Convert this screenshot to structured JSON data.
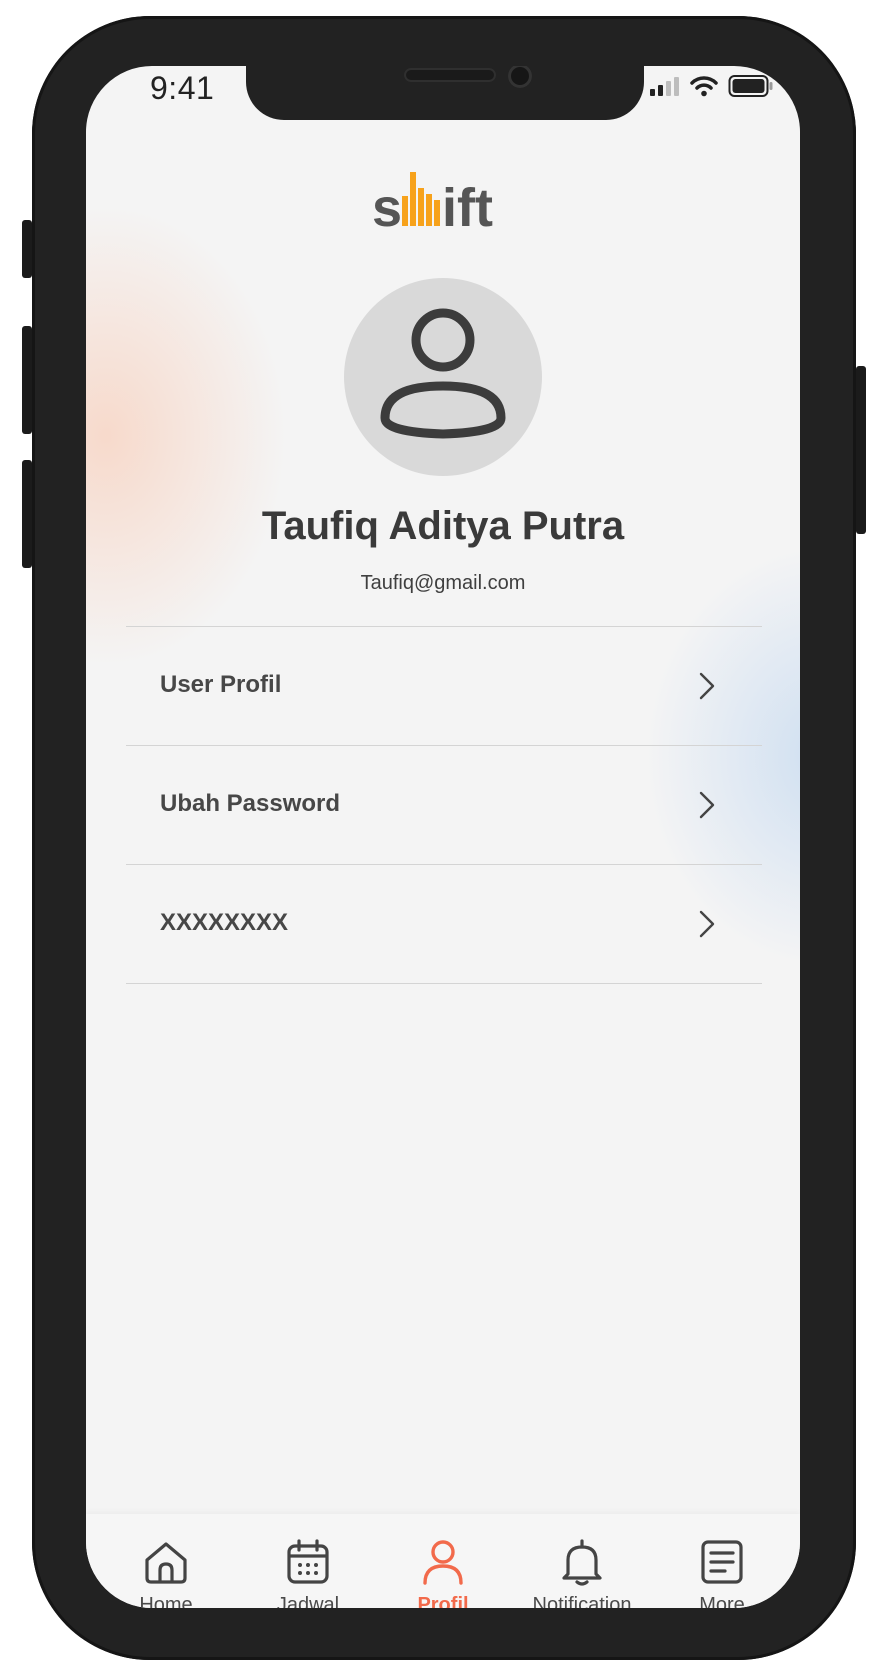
{
  "status_bar": {
    "time": "9:41",
    "icons": [
      "cellular-signal-icon",
      "wifi-icon",
      "battery-icon"
    ]
  },
  "brand": {
    "logo_text": "swift",
    "colors": {
      "dark": "#555555",
      "accent": "#f7a21b"
    }
  },
  "profile": {
    "name": "Taufiq Aditya Putra",
    "email": "Taufiq@gmail.com",
    "avatar_icon": "user-avatar-icon"
  },
  "menu": {
    "items": [
      {
        "label": "User Profil",
        "icon": "chevron-right-icon"
      },
      {
        "label": "Ubah Password",
        "icon": "chevron-right-icon"
      },
      {
        "label": "XXXXXXXX",
        "icon": "chevron-right-icon"
      }
    ]
  },
  "bottom_nav": {
    "active": "Profil",
    "active_color": "#f26a4b",
    "items": [
      {
        "label": "Home",
        "icon": "home-icon"
      },
      {
        "label": "Jadwal",
        "icon": "calendar-icon"
      },
      {
        "label": "Profil",
        "icon": "profile-icon"
      },
      {
        "label": "Notification",
        "icon": "bell-icon"
      },
      {
        "label": "More",
        "icon": "document-icon"
      }
    ]
  }
}
